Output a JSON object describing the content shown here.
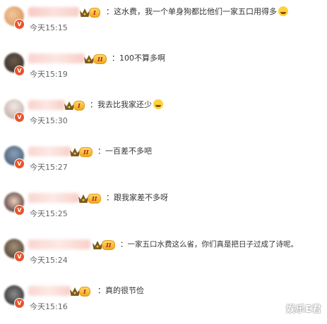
{
  "comments": [
    {
      "text": "：这水费，我一个单身狗都比他们一家五口用得多",
      "time": "今天15:15",
      "level": "I",
      "emoji": "laugh-cry-emoji"
    },
    {
      "text": "：100不算多啊",
      "time": "今天15:19",
      "level": "II"
    },
    {
      "text": "：我去比我家还少",
      "time": "今天15:30",
      "level": "I",
      "emoji": "crying-emoji"
    },
    {
      "text": "：一百差不多吧",
      "time": "今天15:27",
      "level": "II"
    },
    {
      "text": "：跟我家差不多呀",
      "time": "今天15:25",
      "level": "II"
    },
    {
      "text": "：一家五口水费这么省，你们真是把日子过成了诗呢。",
      "time": "今天15:24",
      "level": "II"
    },
    {
      "text": "：真的很节俭",
      "time": "今天15:16",
      "level": "I"
    }
  ],
  "watermark": "娱乐E君",
  "verified_badge": "V",
  "colors": {
    "badge": "#e8542b",
    "level_gold": "#f3a81b",
    "text": "#333333",
    "time": "#666666"
  }
}
